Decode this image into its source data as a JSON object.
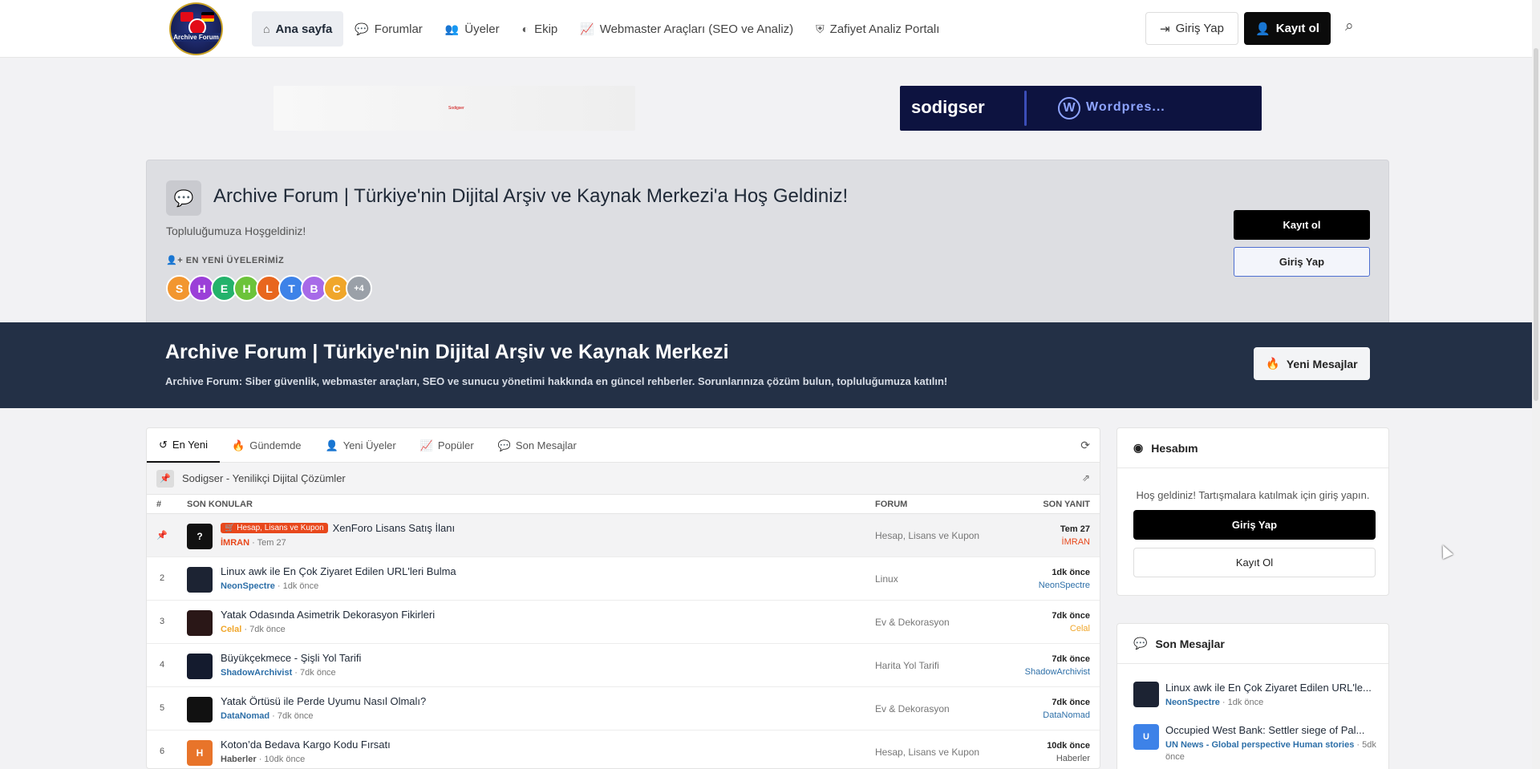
{
  "nav": {
    "logo_text": "Archive Forum",
    "links": [
      {
        "label": "Ana sayfa",
        "icon": "home-icon"
      },
      {
        "label": "Forumlar",
        "icon": "comments-icon"
      },
      {
        "label": "Üyeler",
        "icon": "users-icon"
      },
      {
        "label": "Ekip",
        "icon": "shield-icon"
      },
      {
        "label": "Webmaster Araçları (SEO ve Analiz)",
        "icon": "chart-line-icon"
      },
      {
        "label": "Zafiyet Analiz Portalı",
        "icon": "shield-check-icon"
      }
    ],
    "login": "Giriş Yap",
    "register": "Kayıt ol"
  },
  "ads": {
    "left_text": "Sodigser",
    "right_brand": "sodigser",
    "right_wp": "Wordpres..."
  },
  "welcome": {
    "title": "Archive Forum | Türkiye'nin Dijital Arşiv ve Kaynak Merkezi'a Hoş Geldiniz!",
    "subtitle": "Topluluğumuza Hoşgeldiniz!",
    "new_members_label": "EN YENİ ÜYELERİMİZ",
    "members": [
      {
        "letter": "S",
        "color": "#f2962f"
      },
      {
        "letter": "H",
        "color": "#9b3fd8"
      },
      {
        "letter": "E",
        "color": "#24b26b"
      },
      {
        "letter": "H",
        "color": "#6cc33a"
      },
      {
        "letter": "L",
        "color": "#e8661e"
      },
      {
        "letter": "T",
        "color": "#3d82e8"
      },
      {
        "letter": "B",
        "color": "#a76ae8"
      },
      {
        "letter": "C",
        "color": "#f0a62a"
      }
    ],
    "more": "+4",
    "register": "Kayıt ol",
    "login": "Giriş Yap"
  },
  "hero": {
    "title": "Archive Forum | Türkiye'nin Dijital Arşiv ve Kaynak Merkezi",
    "description": "Archive Forum: Siber güvenlik, webmaster araçları, SEO ve sunucu yönetimi hakkında en güncel rehberler. Sorunlarınıza çözüm bulun, topluluğumuza katılın!",
    "new_messages": "Yeni Mesajlar"
  },
  "tabs": [
    "En Yeni",
    "Gündemde",
    "Yeni Üyeler",
    "Popüler",
    "Son Mesajlar"
  ],
  "pinned_bar": "Sodigser - Yenilikçi Dijital Çözümler",
  "table": {
    "headers": [
      "#",
      "SON KONULAR",
      "FORUM",
      "SON YANIT"
    ],
    "rows": [
      {
        "num": "",
        "title": "XenForo Lisans Satış İlanı",
        "badge": "Hesap, Lisans ve Kupon",
        "author": "İMRAN",
        "author_color": "#e8481c",
        "time": "Tem 27",
        "forum": "Hesap, Lisans ve Kupon",
        "last_time": "Tem 27",
        "last_user": "İMRAN",
        "last_color": "#e8481c",
        "avatar": "?",
        "avatar_color": "#111111"
      },
      {
        "num": "2",
        "title": "Linux awk ile En Çok Ziyaret Edilen URL'leri Bulma",
        "badge": "",
        "author": "NeonSpectre",
        "author_color": "#2d6fa8",
        "time": "1dk önce",
        "forum": "Linux",
        "last_time": "1dk önce",
        "last_user": "NeonSpectre",
        "last_color": "#2d6fa8",
        "avatar": "",
        "avatar_color": "#1c2333"
      },
      {
        "num": "3",
        "title": "Yatak Odasında Asimetrik Dekorasyon Fikirleri",
        "badge": "",
        "author": "Celal",
        "author_color": "#f0a62a",
        "time": "7dk önce",
        "forum": "Ev & Dekorasyon",
        "last_time": "7dk önce",
        "last_user": "Celal",
        "last_color": "#f0a62a",
        "avatar": "",
        "avatar_color": "#2a1717"
      },
      {
        "num": "4",
        "title": "Büyükçekmece - Şişli Yol Tarifi",
        "badge": "",
        "author": "ShadowArchivist",
        "author_color": "#2d6fa8",
        "time": "7dk önce",
        "forum": "Harita Yol Tarifi",
        "last_time": "7dk önce",
        "last_user": "ShadowArchivist",
        "last_color": "#2d6fa8",
        "avatar": "",
        "avatar_color": "#141b2e"
      },
      {
        "num": "5",
        "title": "Yatak Örtüsü ile Perde Uyumu Nasıl Olmalı?",
        "badge": "",
        "author": "DataNomad",
        "author_color": "#2d6fa8",
        "time": "7dk önce",
        "forum": "Ev & Dekorasyon",
        "last_time": "7dk önce",
        "last_user": "DataNomad",
        "last_color": "#2d6fa8",
        "avatar": "",
        "avatar_color": "#111111"
      },
      {
        "num": "6",
        "title": "Koton’da Bedava Kargo Kodu Fırsatı",
        "badge": "",
        "author": "Haberler",
        "author_color": "#555555",
        "time": "10dk önce",
        "forum": "Hesap, Lisans ve Kupon",
        "last_time": "10dk önce",
        "last_user": "Haberler",
        "last_color": "#555555",
        "avatar": "H",
        "avatar_color": "#e8742a"
      }
    ]
  },
  "account": {
    "title": "Hesabım",
    "text": "Hoş geldiniz! Tartışmalara katılmak için giriş yapın.",
    "login": "Giriş Yap",
    "register": "Kayıt Ol"
  },
  "recent": {
    "title": "Son Mesajlar",
    "items": [
      {
        "title": "Linux awk ile En Çok Ziyaret Edilen URL'le...",
        "user": "NeonSpectre",
        "meta": "1dk önce",
        "avatar": "",
        "avatar_color": "#1c2333"
      },
      {
        "title": "Occupied West Bank: Settler siege of Pal...",
        "user": "UN News - Global perspective Human stories",
        "meta": "5dk önce",
        "avatar": "U",
        "avatar_color": "#3d82e8"
      }
    ]
  }
}
